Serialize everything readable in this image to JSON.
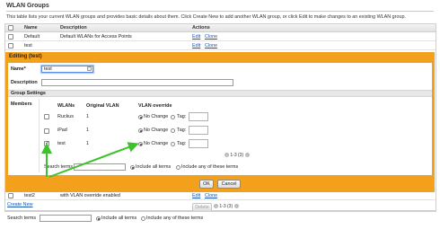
{
  "section_title": "WLAN Groups",
  "description": "This table lists your current WLAN groups and provides basic details about them. Click Create New to add another WLAN group, or click Edit to make changes to an existing WLAN group.",
  "table": {
    "headers": {
      "name": "Name",
      "description": "Description",
      "actions": "Actions"
    },
    "rows": [
      {
        "name": "Default",
        "description": "Default WLANs for Access Points",
        "edit": "Edit",
        "clone": "Clone"
      },
      {
        "name": "test",
        "description": "",
        "edit": "Edit",
        "clone": "Clone"
      },
      {
        "name": "test2",
        "description": "with VLAN override enabled",
        "edit": "Edit",
        "clone": "Clone"
      }
    ]
  },
  "editor": {
    "title": "Editing (test)",
    "name_label": "Name*",
    "name_value": "test",
    "description_label": "Description",
    "description_value": "",
    "group_settings_label": "Group Settings",
    "members_label": "Members",
    "columns": {
      "wlans": "WLANs",
      "original_vlan": "Original VLAN",
      "vlan_override": "VLAN override"
    },
    "wlans": [
      {
        "name": "Ruckus",
        "original_vlan": "1",
        "checked": false,
        "no_change_label": "No Change",
        "tag_label": "Tag:"
      },
      {
        "name": "iPad",
        "original_vlan": "1",
        "checked": false,
        "no_change_label": "No Change",
        "tag_label": "Tag:"
      },
      {
        "name": "test",
        "original_vlan": "1",
        "checked": true,
        "no_change_label": "No Change",
        "tag_label": "Tag:"
      }
    ],
    "pager": "1-3 (3)",
    "search_label": "Search terms",
    "include_all_label": "Include all terms",
    "include_any_label": "Include any of these terms",
    "ok_label": "OK",
    "cancel_label": "Cancel"
  },
  "footer": {
    "create_new": "Create New",
    "delete_label": "Delete",
    "pager": "1-3 (3)",
    "search_label": "Search terms",
    "include_all_label": "Include all terms",
    "include_any_label": "Include any of these terms"
  },
  "colors": {
    "editor_border": "#f3a11c",
    "link": "#1a56b0",
    "annotation_arrow": "#3ec12c"
  }
}
